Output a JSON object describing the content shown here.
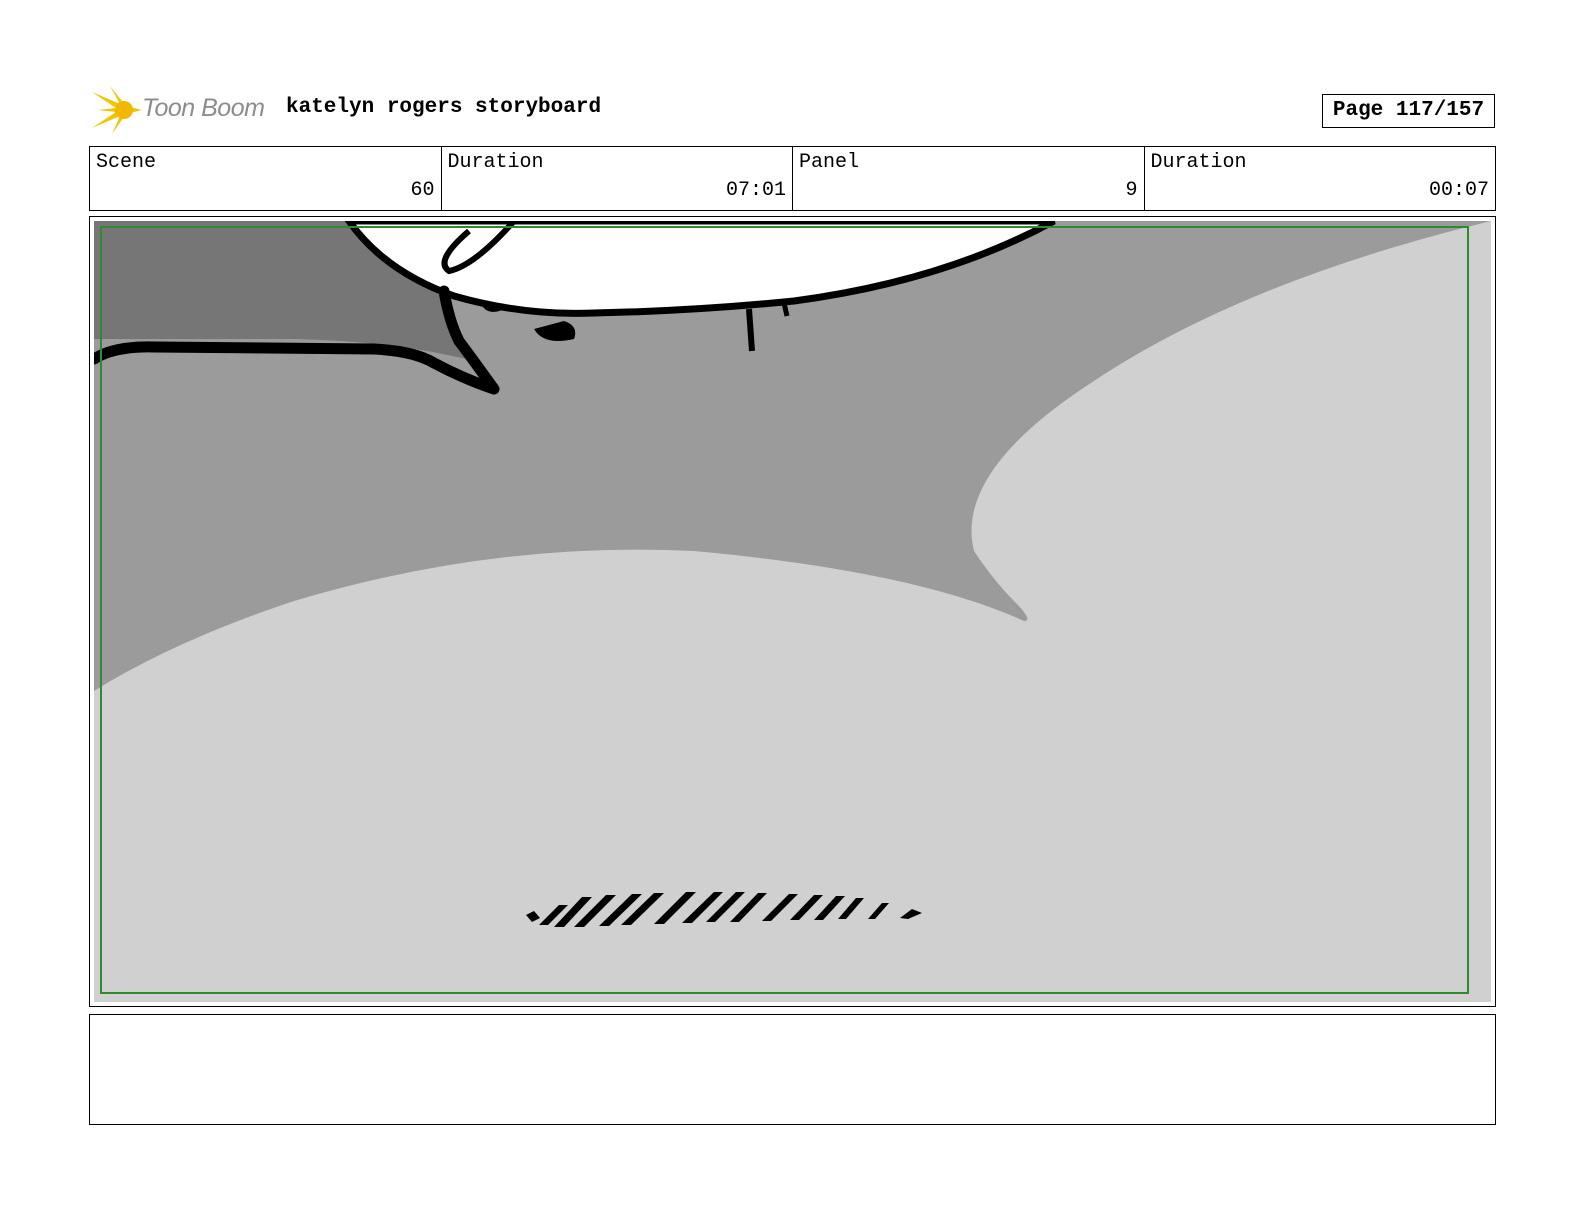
{
  "header": {
    "logo_text": "Toon Boom",
    "title": "katelyn rogers storyboard",
    "page_label": "Page 117/157"
  },
  "info": {
    "scene_label": "Scene",
    "scene_value": "60",
    "scene_duration_label": "Duration",
    "scene_duration_value": "07:01",
    "panel_label": "Panel",
    "panel_value": "9",
    "panel_duration_label": "Duration",
    "panel_duration_value": "00:07"
  },
  "notes": {
    "text": ""
  },
  "colors": {
    "logo_yellow": "#f5c400",
    "safe_frame_green": "#2e8b2e",
    "shadow_dark": "#767676",
    "shadow_mid": "#9b9b9b",
    "ground_light": "#d0d0d0"
  }
}
